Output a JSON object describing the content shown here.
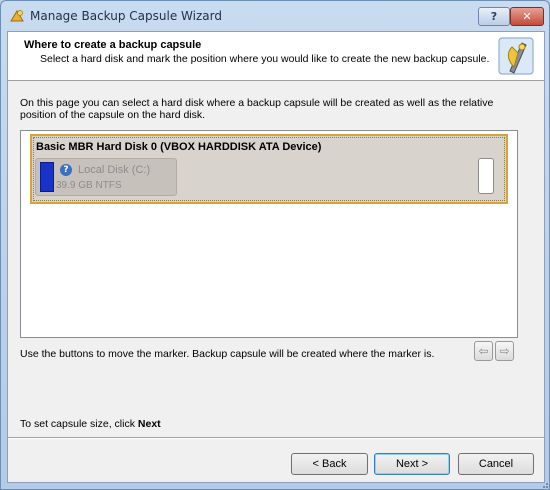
{
  "window": {
    "title": "Manage Backup Capsule Wizard",
    "help_label": "?",
    "close_label": "✕"
  },
  "header": {
    "title": "Where to create a backup capsule",
    "subtitle": "Select a hard disk and mark the position where you would like to create the new backup capsule."
  },
  "intro_text": "On this page you can select a hard disk where a backup capsule will be created as well as the relative position of the capsule on the hard disk.",
  "disk": {
    "name": "Basic MBR Hard Disk 0 (VBOX HARDDISK ATA Device)",
    "partition_name": "Local Disk (C:)",
    "partition_size": "39.9 GB NTFS",
    "partition_icon": "question-icon",
    "partition_color": "#1a33c7"
  },
  "marker_text": "Use the buttons to move the marker. Backup capsule will be created where the marker is.",
  "capsule_text_prefix": "To set capsule size, click ",
  "capsule_text_bold": "Next",
  "buttons": {
    "back": "< Back",
    "next": "Next >",
    "cancel": "Cancel"
  },
  "arrows": {
    "left": "⇦",
    "right": "⇨"
  }
}
